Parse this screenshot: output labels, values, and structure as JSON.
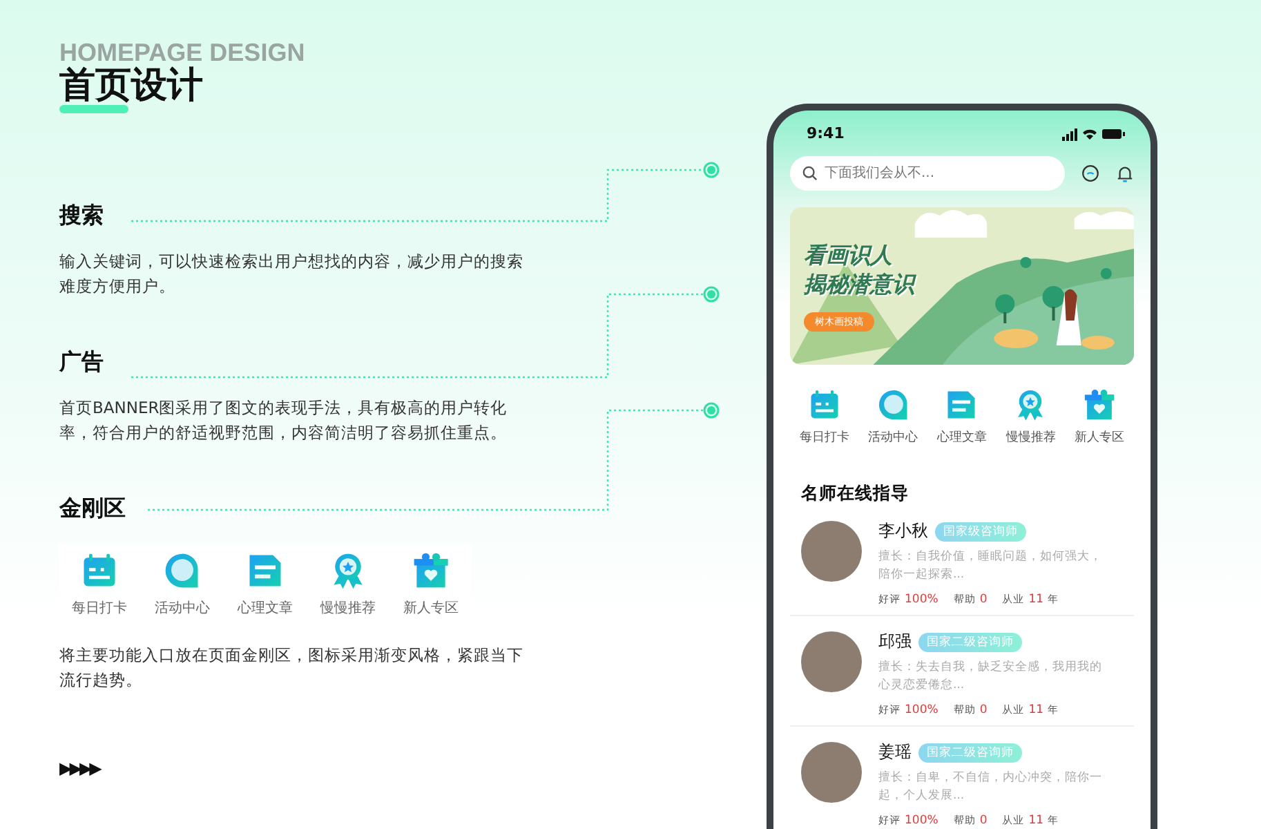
{
  "page": {
    "subtitle": "HOMEPAGE DESIGN",
    "title": "首页设计"
  },
  "sections": [
    {
      "heading": "搜索",
      "description": "输入关键词，可以快速检索出用户想找的内容，减少用户的搜索难度方便用户。"
    },
    {
      "heading": "广告",
      "description": "首页BANNER图采用了图文的表现手法，具有极高的用户转化率，符合用户的舒适视野范围，内容简洁明了容易抓住重点。"
    },
    {
      "heading": "金刚区",
      "description": "将主要功能入口放在页面金刚区，图标采用渐变风格，紧跟当下流行趋势。"
    }
  ],
  "shortcuts": [
    {
      "label": "每日打卡",
      "kind": "calendar"
    },
    {
      "label": "活动中心",
      "kind": "bubble"
    },
    {
      "label": "心理文章",
      "kind": "document"
    },
    {
      "label": "慢慢推荐",
      "kind": "badge"
    },
    {
      "label": "新人专区",
      "kind": "gift"
    }
  ],
  "footer_mark": "▶▶▶▶",
  "phone": {
    "time": "9:41",
    "search": {
      "placeholder": "下面我们会从不..."
    },
    "banner": {
      "lines": [
        "看画识人",
        "揭秘潜意识"
      ],
      "button": "树木画投稿"
    },
    "shortcuts": [
      {
        "label": "每日打卡",
        "kind": "calendar"
      },
      {
        "label": "活动中心",
        "kind": "bubble"
      },
      {
        "label": "心理文章",
        "kind": "document"
      },
      {
        "label": "慢慢推荐",
        "kind": "badge"
      },
      {
        "label": "新人专区",
        "kind": "gift"
      }
    ],
    "section_title": "名师在线指导",
    "counselors": [
      {
        "name": "李小秋",
        "tag": "国家级咨询师",
        "bio": "擅长：自我价值，睡眠问题，如何强大，陪你一起探索...",
        "rating_label": "好评",
        "rating": "100%",
        "help_label": "帮助",
        "help": "0",
        "years_label": "从业",
        "years": "11",
        "years_unit": "年"
      },
      {
        "name": "邱强",
        "tag": "国家二级咨询师",
        "bio": "擅长：失去自我，缺乏安全感，我用我的心灵恋爱倦怠...",
        "rating_label": "好评",
        "rating": "100%",
        "help_label": "帮助",
        "help": "0",
        "years_label": "从业",
        "years": "11",
        "years_unit": "年"
      },
      {
        "name": "姜瑶",
        "tag": "国家二级咨询师",
        "bio": "擅长：自卑，不自信，内心冲突，陪你一起，个人发展...",
        "rating_label": "好评",
        "rating": "100%",
        "help_label": "帮助",
        "help": "0",
        "years_label": "从业",
        "years": "11",
        "years_unit": "年"
      }
    ]
  }
}
